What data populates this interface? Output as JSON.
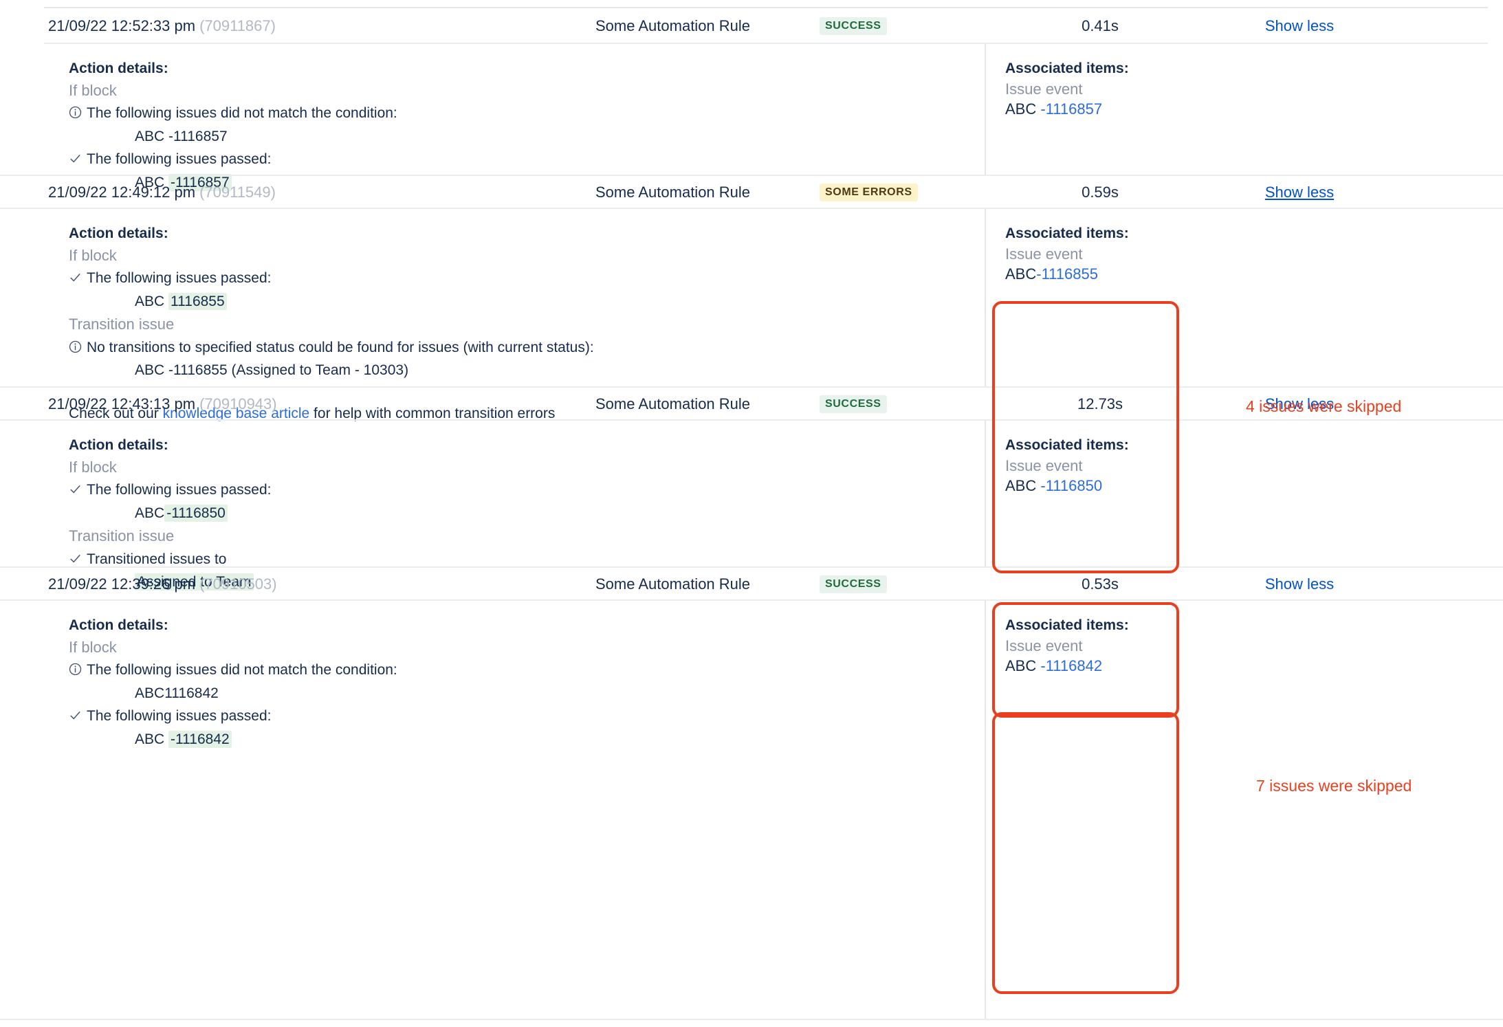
{
  "rows": [
    {
      "timestamp": "21/09/22 12:52:33 pm",
      "rule_id": "(70911867)",
      "rule_name": "Some Automation Rule",
      "status": "SUCCESS",
      "status_kind": "success",
      "duration": "0.41s",
      "toggle_label": "Show less",
      "details": {
        "title": "Action details:",
        "blocks": [
          {
            "label": "If block"
          },
          {
            "glyph": "info-icon",
            "text": "The following issues did not match the condition:"
          },
          {
            "issue_key": "ABC",
            "issue_sep": " -",
            "issue_number": "1116857",
            "highlight": false
          },
          {
            "glyph": "check-icon",
            "text": "The following issues passed:"
          },
          {
            "issue_key": "ABC",
            "issue_sep": "-",
            "issue_number": "1116857",
            "highlight": true
          }
        ]
      },
      "associated": {
        "title": "Associated items:",
        "type": "Issue event",
        "issue_key": "ABC",
        "issue_link": "-1116857"
      }
    },
    {
      "timestamp": "21/09/22 12:49:12 pm",
      "rule_id": "(70911549)",
      "rule_name": "Some Automation Rule",
      "status": "SOME ERRORS",
      "status_kind": "some-errors",
      "duration": "0.59s",
      "toggle_label": "Show less",
      "details": {
        "title": "Action details:",
        "blocks": [
          {
            "label": "If block"
          },
          {
            "glyph": "check-icon",
            "text": "The following issues passed:"
          },
          {
            "issue_key": "ABC",
            "issue_sep": "",
            "issue_number": "1116855",
            "highlight": true
          },
          {
            "label": "Transition issue"
          },
          {
            "glyph": "info-icon",
            "text": "No transitions to specified status could be found for issues (with current status):"
          },
          {
            "issue_key": "ABC",
            "issue_sep": " -",
            "issue_number": "1116855 (Assigned to Team - 10303)",
            "highlight": false
          }
        ],
        "note_prefix": "Check out our ",
        "note_link": "knowledge base article",
        "note_suffix": " for help with common transition errors"
      },
      "associated": {
        "title": "Associated items:",
        "type": "Issue event",
        "issue_key": "ABC",
        "issue_link": "-1116855"
      }
    },
    {
      "timestamp": "21/09/22 12:43:13 pm",
      "rule_id": "(70910943)",
      "rule_name": "Some Automation Rule",
      "status": "SUCCESS",
      "status_kind": "success",
      "duration": "12.73s",
      "toggle_label": "Show less",
      "details": {
        "title": "Action details:",
        "blocks": [
          {
            "label": "If block"
          },
          {
            "glyph": "check-icon",
            "text": "The following issues passed:"
          },
          {
            "issue_key": "ABC",
            "issue_sep": "-",
            "issue_number": "1116850",
            "highlight": true
          },
          {
            "label": "Transition issue"
          },
          {
            "glyph": "check-icon",
            "text": "Transitioned issues to"
          },
          {
            "status_pill": "Assigned to Team"
          }
        ]
      },
      "associated": {
        "title": "Associated items:",
        "type": "Issue event",
        "issue_key": "ABC",
        "issue_link": "-1116850"
      }
    },
    {
      "timestamp": "21/09/22 12:39:26 pm",
      "rule_id": "(70910503)",
      "rule_name": "Some Automation Rule",
      "status": "SUCCESS",
      "status_kind": "success",
      "duration": "0.53s",
      "toggle_label": "Show less",
      "details": {
        "title": "Action details:",
        "blocks": [
          {
            "label": "If block"
          },
          {
            "glyph": "info-icon",
            "text": "The following issues did not match the condition:"
          },
          {
            "issue_key": "ABC",
            "issue_sep": "",
            "issue_number": "1116842",
            "highlight": false
          },
          {
            "glyph": "check-icon",
            "text": "The following issues passed:"
          },
          {
            "issue_key": "ABC",
            "issue_sep": "-",
            "issue_number": "1116842",
            "highlight": true
          }
        ]
      },
      "associated": {
        "title": "Associated items:",
        "type": "Issue event",
        "issue_key": "ABC",
        "issue_link": "-1116842"
      }
    }
  ],
  "annotations": {
    "skipped_4": "4 issues were skipped",
    "skipped_7": "7 issues were skipped",
    "box_color": "#e8401f"
  },
  "colors": {
    "link": "#0052cc",
    "issue_link": "#2b6cde",
    "success_bg": "#e7f3ec",
    "success_fg": "#1f6b3b",
    "error_bg": "#fcf3ca",
    "error_fg": "#4f3a10",
    "highlight_bg": "#e3f2e4",
    "muted": "#8993a4"
  }
}
